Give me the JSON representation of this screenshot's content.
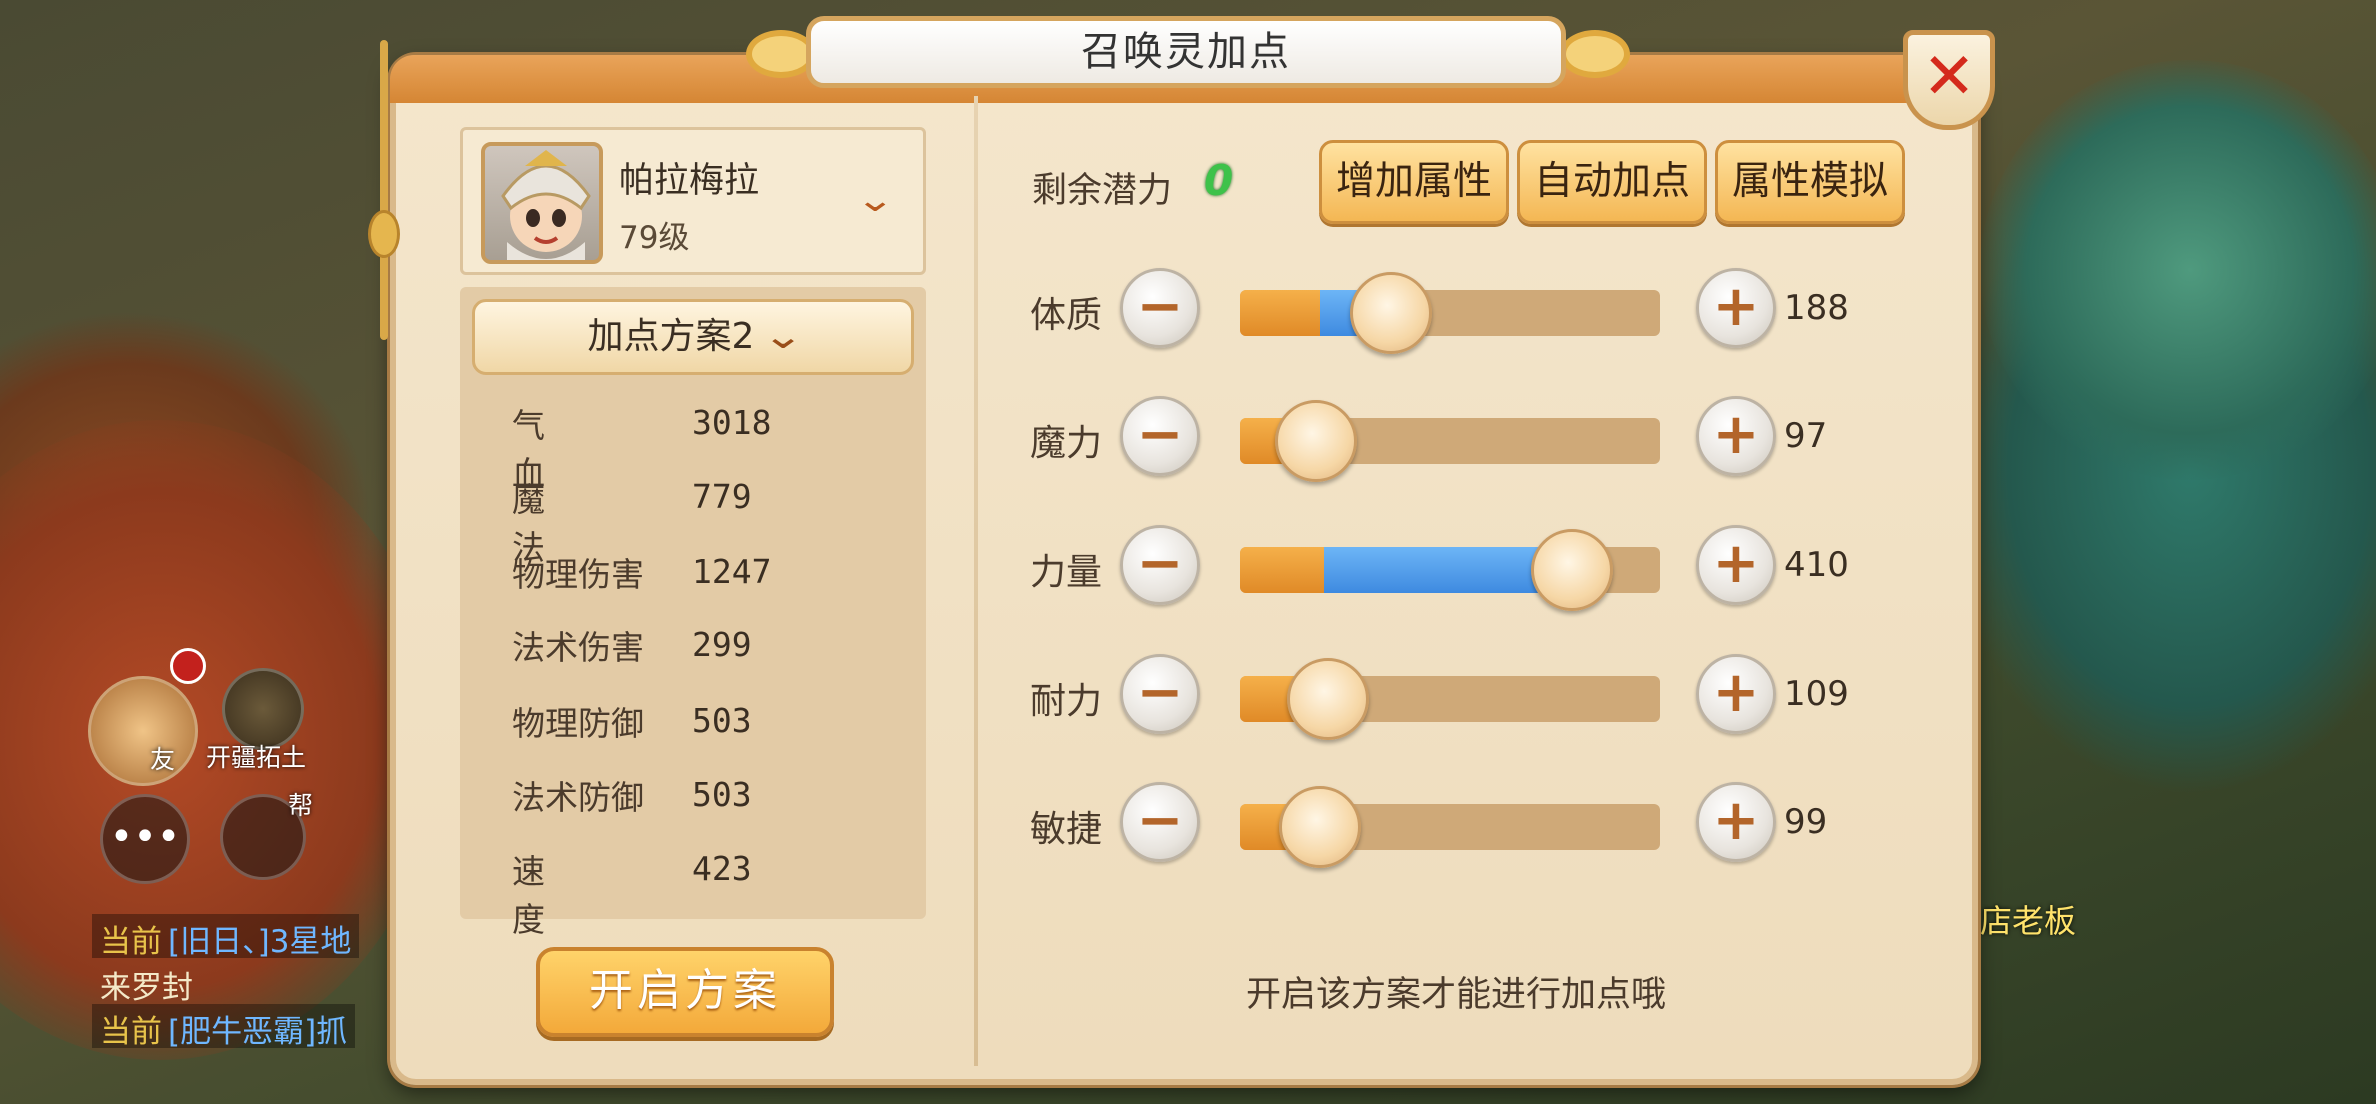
{
  "background": {
    "chat": [
      {
        "tag": "当前",
        "text": "[旧日、]3星地",
        "tail": "来罗封"
      },
      {
        "tag": "当前",
        "text": "[肥牛恶霸]抓"
      }
    ],
    "hud_labels": {
      "friend_suffix": "友",
      "explore": "开疆拓土",
      "help": "帮"
    },
    "npc_name": "店老板"
  },
  "dialog": {
    "title": "召唤灵加点",
    "close_icon": "close-x-icon",
    "pet": {
      "name": "帕拉梅拉",
      "level": "79级",
      "toggle_icon": "chevron-down-icon"
    },
    "plan": {
      "label": "加点方案2",
      "chevron": "⌄"
    },
    "stats": [
      {
        "label": "气血",
        "value": "3018",
        "spread": true
      },
      {
        "label": "魔法",
        "value": "779",
        "spread": true
      },
      {
        "label": "物理伤害",
        "value": "1247",
        "spread": false
      },
      {
        "label": "法术伤害",
        "value": "299",
        "spread": false
      },
      {
        "label": "物理防御",
        "value": "503",
        "spread": false
      },
      {
        "label": "法术防御",
        "value": "503",
        "spread": false
      },
      {
        "label": "速度",
        "value": "423",
        "spread": true
      }
    ],
    "start_plan_label": "开启方案",
    "potential": {
      "label": "剩余潜力",
      "value": "0"
    },
    "buttons": {
      "add": "增加属性",
      "auto": "自动加点",
      "simulate": "属性模拟"
    },
    "attributes": [
      {
        "name": "体质",
        "value": "188",
        "base": 0.19,
        "fill": 0.36
      },
      {
        "name": "魔力",
        "value": "97",
        "base": 0.18,
        "fill": 0.18
      },
      {
        "name": "力量",
        "value": "410",
        "base": 0.2,
        "fill": 0.79
      },
      {
        "name": "耐力",
        "value": "109",
        "base": 0.2,
        "fill": 0.21
      },
      {
        "name": "敏捷",
        "value": "99",
        "base": 0.19,
        "fill": 0.19
      }
    ],
    "hint": "开启该方案才能进行加点哦",
    "colors": {
      "accent": "#f3a93a",
      "bar_base": "#e08a27",
      "bar_fill": "#3e8ae0",
      "close": "#d42a1c",
      "potential": "#3ec24a"
    }
  }
}
